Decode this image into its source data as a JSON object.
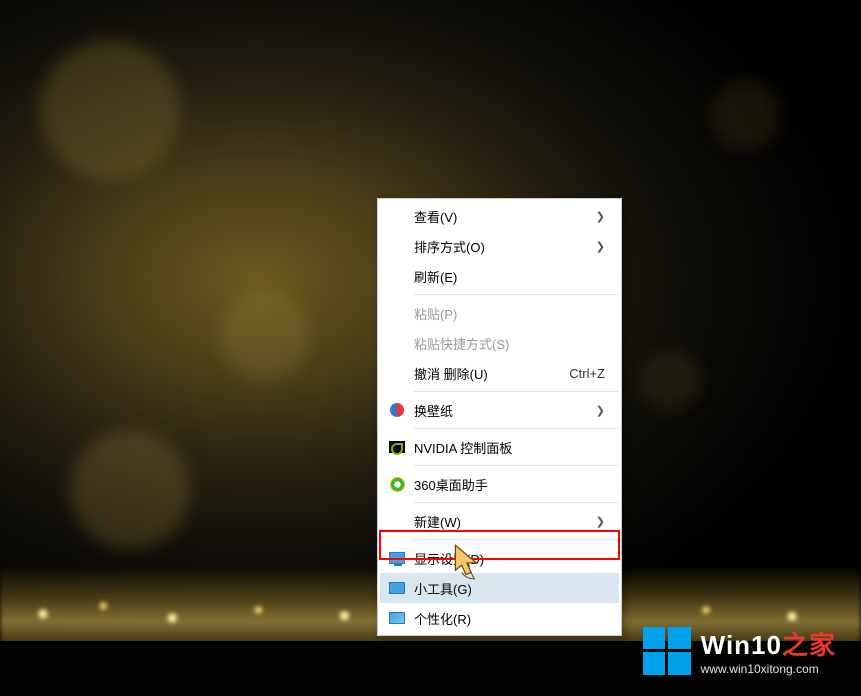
{
  "menu": {
    "items": [
      {
        "id": "view",
        "label": "查看(V)",
        "type": "submenu"
      },
      {
        "id": "sort",
        "label": "排序方式(O)",
        "type": "submenu"
      },
      {
        "id": "refresh",
        "label": "刷新(E)",
        "type": "item"
      }
    ],
    "items2": [
      {
        "id": "paste",
        "label": "粘贴(P)",
        "type": "item",
        "disabled": true
      },
      {
        "id": "paste-shortcut",
        "label": "粘贴快捷方式(S)",
        "type": "item",
        "disabled": true
      },
      {
        "id": "undo-delete",
        "label": "撤消 删除(U)",
        "type": "item",
        "shortcut": "Ctrl+Z"
      }
    ],
    "items3": [
      {
        "id": "wallpaper",
        "label": "换壁纸",
        "type": "submenu",
        "icon": "wallpaper"
      }
    ],
    "items4": [
      {
        "id": "nvidia",
        "label": "NVIDIA 控制面板",
        "type": "item",
        "icon": "nvidia"
      }
    ],
    "items5": [
      {
        "id": "360",
        "label": "360桌面助手",
        "type": "item",
        "icon": "360"
      }
    ],
    "items6": [
      {
        "id": "new",
        "label": "新建(W)",
        "type": "submenu"
      }
    ],
    "items7": [
      {
        "id": "display",
        "label": "显示设置(D)",
        "type": "item",
        "icon": "display"
      },
      {
        "id": "gadgets",
        "label": "小工具(G)",
        "type": "item",
        "icon": "gadget",
        "hover": true
      },
      {
        "id": "personalize",
        "label": "个性化(R)",
        "type": "item",
        "icon": "personalize"
      }
    ]
  },
  "watermark": {
    "brand_main": "Win10",
    "brand_suffix": "之家",
    "url": "www.win10xitong.com"
  }
}
